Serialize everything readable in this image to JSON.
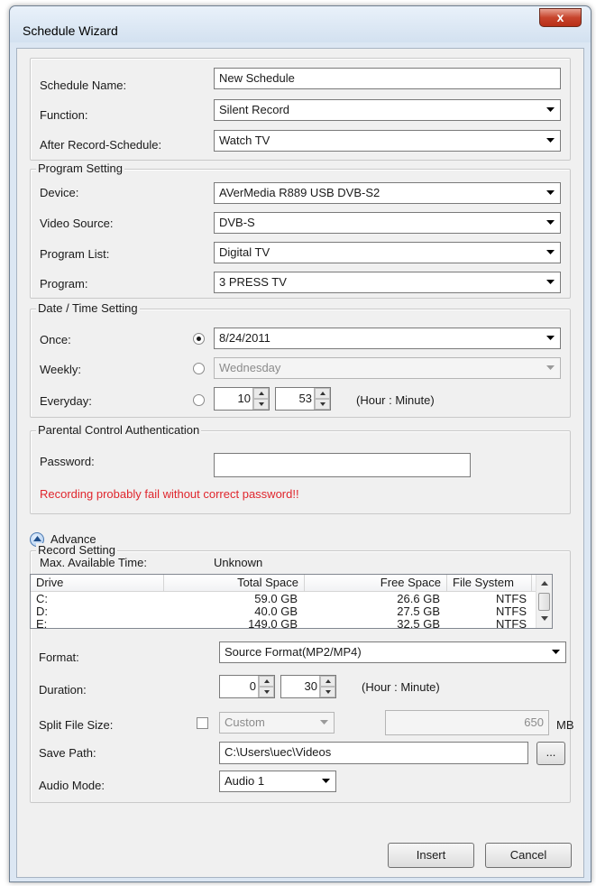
{
  "window": {
    "title": "Schedule Wizard",
    "close_label": "x"
  },
  "general": {
    "schedule_name_label": "Schedule Name:",
    "schedule_name_value": "New Schedule",
    "function_label": "Function:",
    "function_value": "Silent Record",
    "after_record_label": "After Record-Schedule:",
    "after_record_value": "Watch TV"
  },
  "program_setting": {
    "legend": "Program Setting",
    "device_label": "Device:",
    "device_value": "AVerMedia R889 USB DVB-S2",
    "video_source_label": "Video Source:",
    "video_source_value": "DVB-S",
    "program_list_label": "Program List:",
    "program_list_value": "Digital TV",
    "program_label": "Program:",
    "program_value": "3 PRESS TV"
  },
  "date_time": {
    "legend": "Date / Time Setting",
    "once_label": "Once:",
    "once_value": "8/24/2011",
    "weekly_label": "Weekly:",
    "weekly_value": "Wednesday",
    "everyday_label": "Everyday:",
    "hour_value": "10",
    "minute_value": "53",
    "hint": "(Hour : Minute)",
    "selected": "once"
  },
  "parental": {
    "legend": "Parental Control Authentication",
    "password_label": "Password:",
    "password_value": "",
    "warning": "Recording probably fail without correct password!!"
  },
  "advance": {
    "label": "Advance"
  },
  "record_setting": {
    "legend": "Record Setting",
    "max_time_label": "Max. Available Time:",
    "max_time_value": "Unknown",
    "columns": [
      "Drive",
      "Total Space",
      "Free Space",
      "File System"
    ],
    "rows": [
      {
        "drive": "C:",
        "total": "59.0 GB",
        "free": "26.6 GB",
        "fs": "NTFS"
      },
      {
        "drive": "D:",
        "total": "40.0 GB",
        "free": "27.5 GB",
        "fs": "NTFS"
      },
      {
        "drive": "E:",
        "total": "149.0 GB",
        "free": "32.5 GB",
        "fs": "NTFS"
      }
    ],
    "format_label": "Format:",
    "format_value": "Source Format(MP2/MP4)",
    "duration_label": "Duration:",
    "duration_hour": "0",
    "duration_minute": "30",
    "duration_hint": "(Hour : Minute)",
    "split_label": "Split File Size:",
    "split_checked": false,
    "split_mode": "Custom",
    "split_size": "650",
    "split_unit": "MB",
    "save_path_label": "Save Path:",
    "save_path_value": "C:\\Users\\uec\\Videos",
    "browse_label": "...",
    "audio_mode_label": "Audio Mode:",
    "audio_mode_value": "Audio 1"
  },
  "buttons": {
    "insert": "Insert",
    "cancel": "Cancel"
  },
  "colors": {
    "warning": "#e0262d",
    "title_bar": "#dce7f3",
    "close": "#c7442c"
  }
}
